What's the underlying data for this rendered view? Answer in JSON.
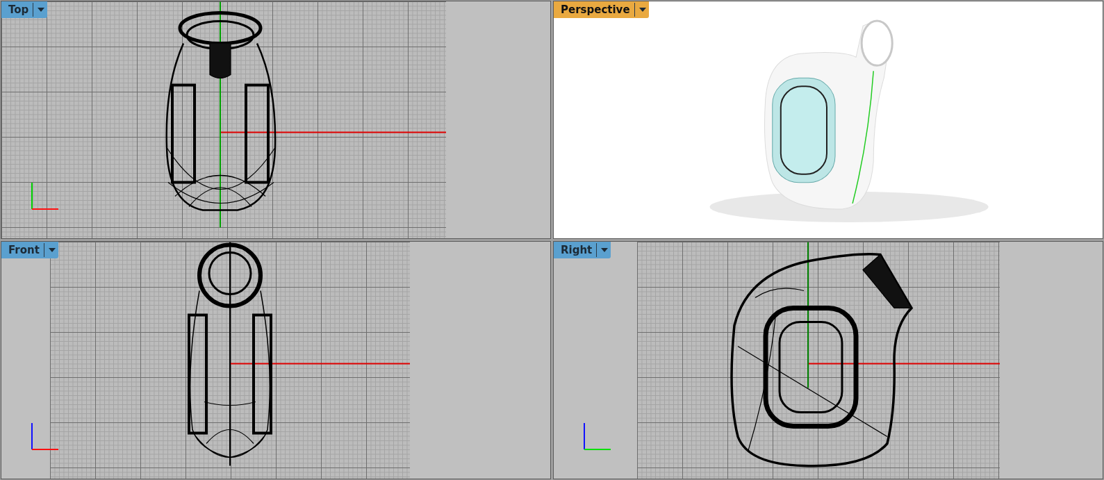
{
  "viewports": [
    {
      "label": "Top",
      "selected": false,
      "kind": "top"
    },
    {
      "label": "Perspective",
      "selected": true,
      "kind": "perspective"
    },
    {
      "label": "Front",
      "selected": false,
      "kind": "front"
    },
    {
      "label": "Right",
      "selected": false,
      "kind": "right"
    }
  ]
}
